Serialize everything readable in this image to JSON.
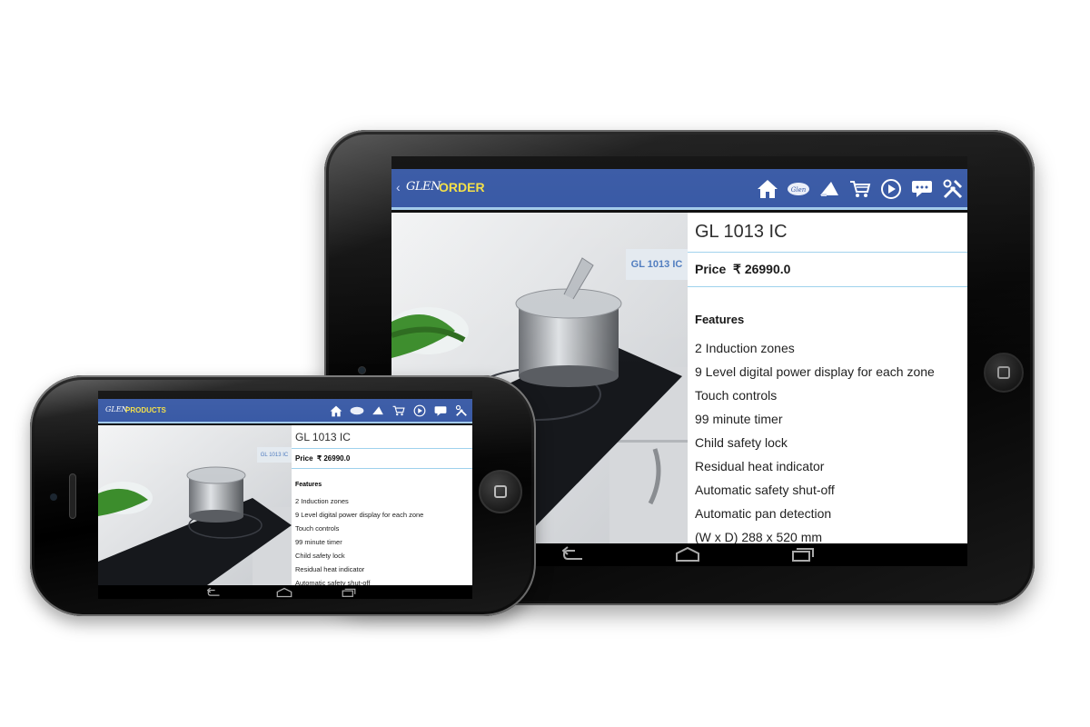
{
  "tablet": {
    "header": {
      "back": "‹",
      "logo": "GLEN",
      "title": "ORDER"
    },
    "product": {
      "photo_tag": "GL 1013 IC",
      "model": "GL 1013 IC",
      "price_label": "Price",
      "price_value": "₹ 26990.0",
      "features_heading": "Features",
      "features": [
        "2 Induction zones",
        "9 Level digital power display for each zone",
        "Touch controls",
        "99 minute timer",
        "Child safety lock",
        "Residual heat indicator",
        "Automatic safety shut-off",
        "Automatic pan detection",
        "(W x D) 288 x 520 mm"
      ]
    }
  },
  "phone": {
    "header": {
      "logo": "GLEN",
      "title": "PRODUCTS"
    },
    "product": {
      "photo_tag": "GL 1013 IC",
      "model": "GL 1013 IC",
      "price_label": "Price",
      "price_value": "₹ 26990.0",
      "features_heading": "Features",
      "features": [
        "2 Induction zones",
        "9 Level digital power display for each zone",
        "Touch controls",
        "99 minute timer",
        "Child safety lock",
        "Residual heat indicator",
        "Automatic safety shut-off"
      ]
    }
  },
  "icons": [
    "home-icon",
    "glen-brand-icon",
    "megaphone-icon",
    "cart-icon",
    "play-icon",
    "chat-icon",
    "tools-icon"
  ],
  "colors": {
    "header": "#2b4e9f",
    "title": "#f3de3a",
    "divider": "#9cd0ec",
    "tag_text": "#4a78bd"
  }
}
